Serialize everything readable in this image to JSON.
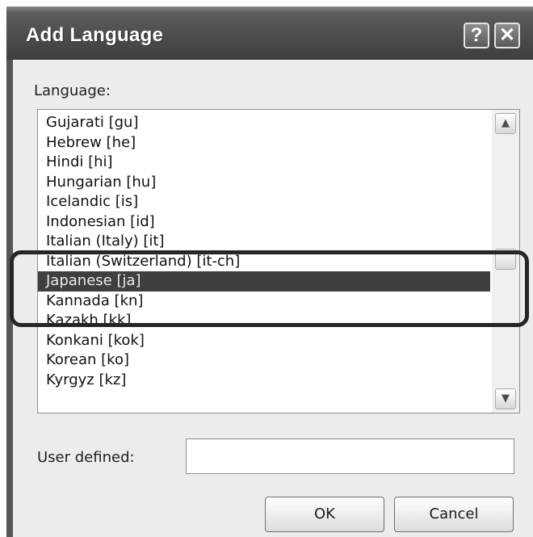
{
  "dialog": {
    "title": "Add Language",
    "help_button": "?",
    "close_button": "✕"
  },
  "language_label": "Language:",
  "languages": [
    "Gujarati [gu]",
    "Hebrew [he]",
    "Hindi [hi]",
    "Hungarian [hu]",
    "Icelandic [is]",
    "Indonesian [id]",
    "Italian (Italy) [it]",
    "Italian (Switzerland) [it-ch]",
    "Japanese [ja]",
    "Kannada [kn]",
    "Kazakh [kk]",
    "Konkani [kok]",
    "Korean [ko]",
    "Kyrgyz [kz]"
  ],
  "selected_language": "Japanese [ja]",
  "scrollbar": {
    "up_arrow": "▲",
    "down_arrow": "▼"
  },
  "user_defined": {
    "label": "User defined:",
    "value": ""
  },
  "buttons": {
    "ok": "OK",
    "cancel": "Cancel"
  }
}
